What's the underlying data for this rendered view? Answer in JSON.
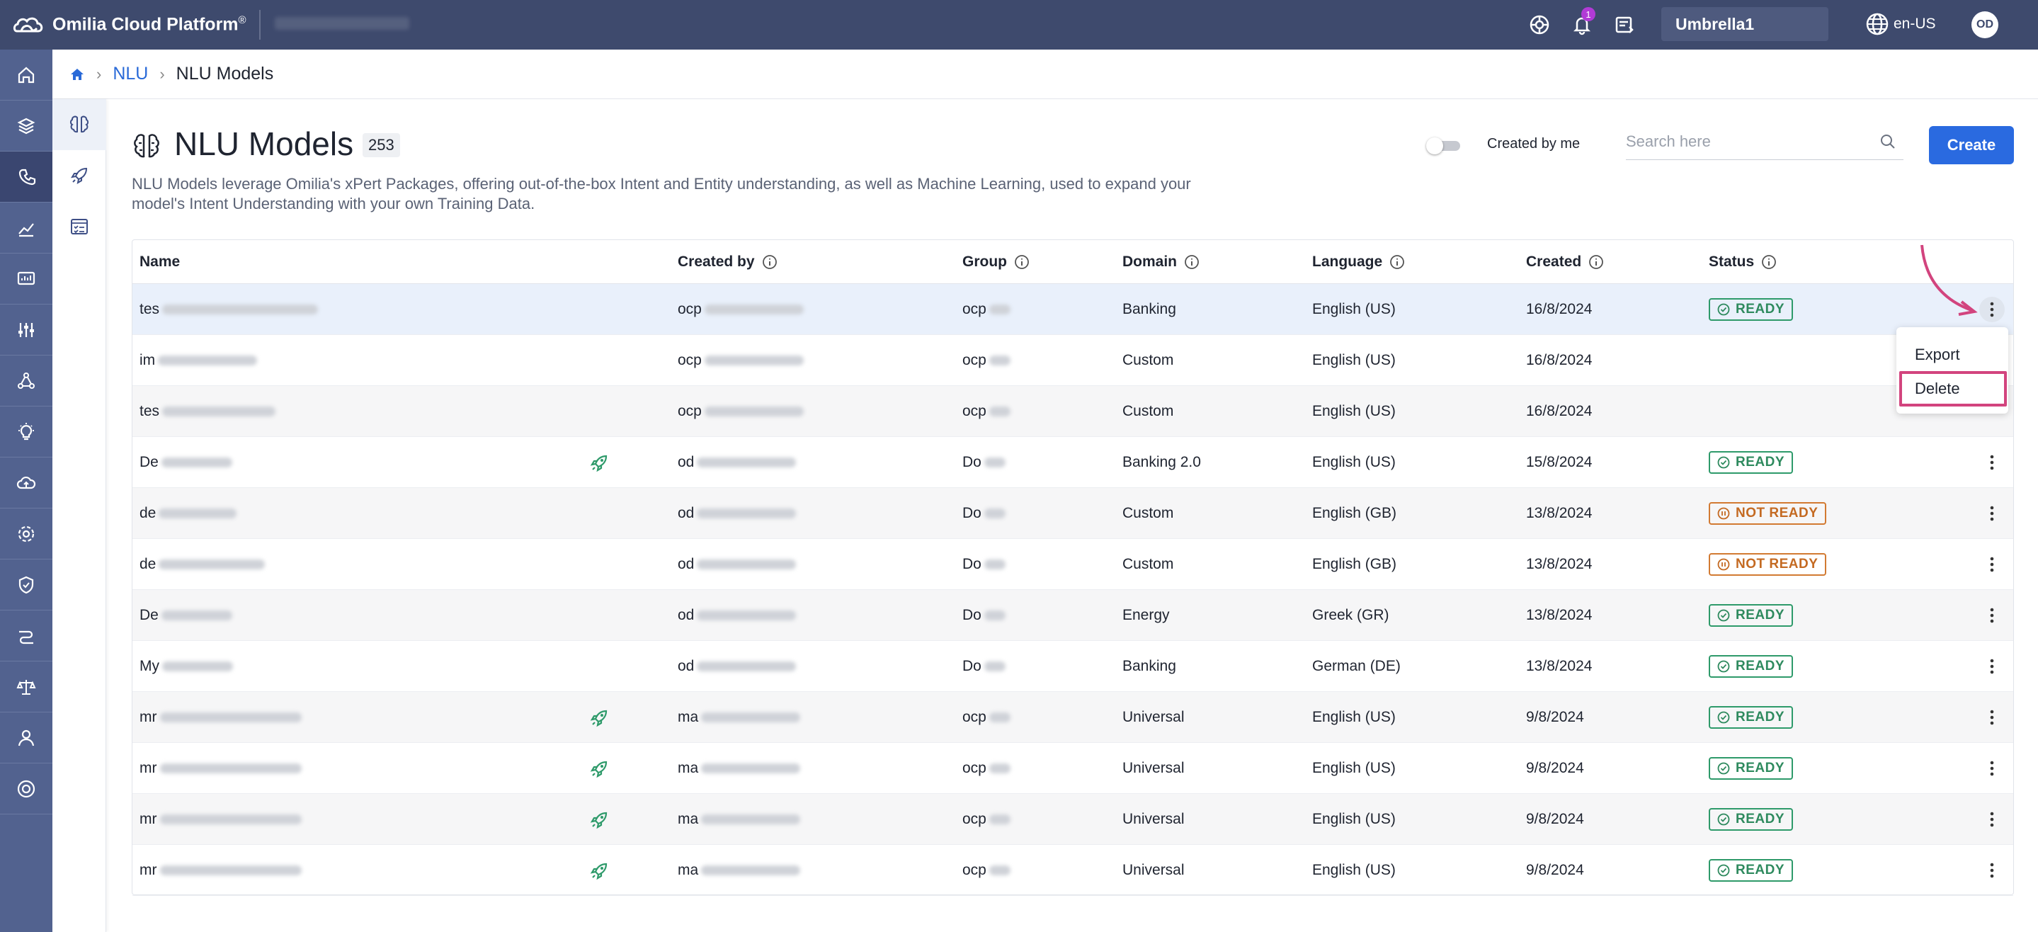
{
  "topbar": {
    "brand": "Omilia Cloud Platform",
    "brand_mark": "®",
    "notifications_count": "1",
    "organization": "Umbrella1",
    "language": "en-US",
    "avatar_initials": "OD"
  },
  "breadcrumb": {
    "parent": "NLU",
    "current": "NLU Models"
  },
  "header": {
    "title": "NLU Models",
    "count": "253",
    "description": "NLU Models leverage Omilia's xPert Packages, offering out-of-the-box Intent and Entity understanding, as well as Machine Learning, used to expand your model's Intent Understanding with your own Training Data.",
    "toggle_label": "Created by me",
    "search_placeholder": "Search here",
    "create_label": "Create"
  },
  "table": {
    "columns": [
      "Name",
      "Created by",
      "Group",
      "Domain",
      "Language",
      "Created",
      "Status"
    ],
    "rows": [
      {
        "name": "tes",
        "created_by": "ocp",
        "group": "ocp",
        "domain": "Banking",
        "language": "English (US)",
        "created": "16/8/2024",
        "status": "READY",
        "rocket": false
      },
      {
        "name": "im",
        "created_by": "ocp",
        "group": "ocp",
        "domain": "Custom",
        "language": "English (US)",
        "created": "16/8/2024",
        "status": "",
        "rocket": false
      },
      {
        "name": "tes",
        "created_by": "ocp",
        "group": "ocp",
        "domain": "Custom",
        "language": "English (US)",
        "created": "16/8/2024",
        "status": "",
        "rocket": false
      },
      {
        "name": "De",
        "created_by": "od",
        "group": "Do",
        "domain": "Banking 2.0",
        "language": "English (US)",
        "created": "15/8/2024",
        "status": "READY",
        "rocket": true
      },
      {
        "name": "de",
        "created_by": "od",
        "group": "Do",
        "domain": "Custom",
        "language": "English (GB)",
        "created": "13/8/2024",
        "status": "NOT READY",
        "rocket": false
      },
      {
        "name": "de",
        "created_by": "od",
        "group": "Do",
        "domain": "Custom",
        "language": "English (GB)",
        "created": "13/8/2024",
        "status": "NOT READY",
        "rocket": false
      },
      {
        "name": "De",
        "created_by": "od",
        "group": "Do",
        "domain": "Energy",
        "language": "Greek (GR)",
        "created": "13/8/2024",
        "status": "READY",
        "rocket": false
      },
      {
        "name": "My",
        "created_by": "od",
        "group": "Do",
        "domain": "Banking",
        "language": "German (DE)",
        "created": "13/8/2024",
        "status": "READY",
        "rocket": false
      },
      {
        "name": "mr",
        "created_by": "ma",
        "group": "ocp",
        "domain": "Universal",
        "language": "English (US)",
        "created": "9/8/2024",
        "status": "READY",
        "rocket": true
      },
      {
        "name": "mr",
        "created_by": "ma",
        "group": "ocp",
        "domain": "Universal",
        "language": "English (US)",
        "created": "9/8/2024",
        "status": "READY",
        "rocket": true
      },
      {
        "name": "mr",
        "created_by": "ma",
        "group": "ocp",
        "domain": "Universal",
        "language": "English (US)",
        "created": "9/8/2024",
        "status": "READY",
        "rocket": true
      },
      {
        "name": "mr",
        "created_by": "ma",
        "group": "ocp",
        "domain": "Universal",
        "language": "English (US)",
        "created": "9/8/2024",
        "status": "READY",
        "rocket": true
      }
    ]
  },
  "row_menu": {
    "items": [
      "Export",
      "Delete"
    ],
    "highlighted": "Delete"
  },
  "colors": {
    "topbar": "#3e4a6d",
    "sidebar": "#52628f",
    "primary": "#2a6ae0",
    "ready": "#2e9a6a",
    "not_ready": "#d27a32",
    "annotation": "#d2447e"
  },
  "icons": {
    "left_nav": [
      "home-icon",
      "layers-icon",
      "phone-icon",
      "analytics-icon",
      "monitor-icon",
      "sliders-icon",
      "network-icon",
      "bulb-icon",
      "cloud-icon",
      "gear-icon",
      "shield-icon",
      "routing-icon",
      "scale-icon",
      "user-icon",
      "support-icon"
    ],
    "sub_nav": [
      "brain-icon",
      "rocket-icon",
      "checklist-icon"
    ]
  }
}
